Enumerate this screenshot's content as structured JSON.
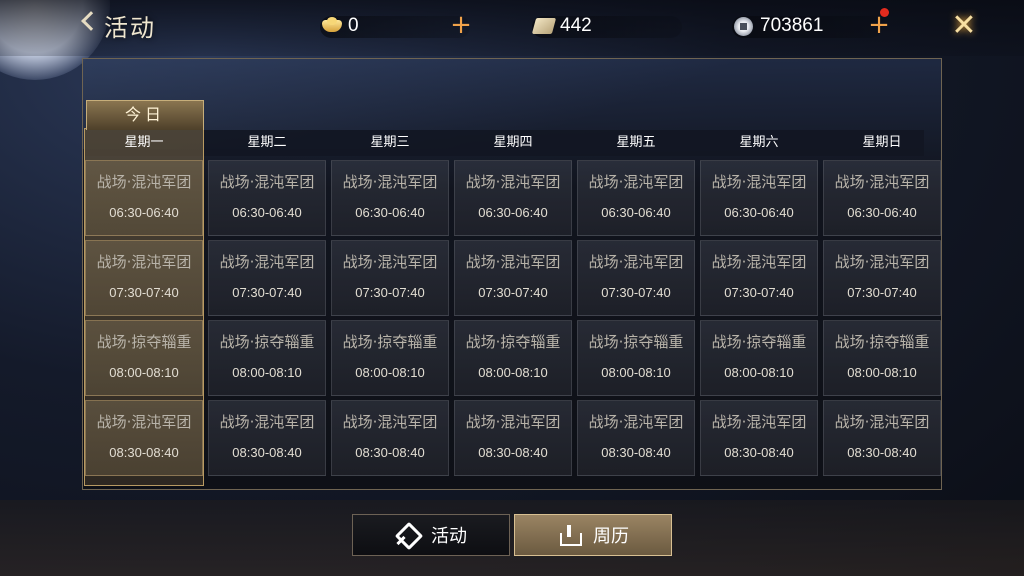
{
  "header": {
    "title": "活动",
    "currencies": [
      {
        "icon": "ingot-icon",
        "value": "0"
      },
      {
        "icon": "scroll-icon",
        "value": "442"
      },
      {
        "icon": "coin-icon",
        "value": "703861"
      }
    ],
    "plus_label": "+",
    "close_label": "✕"
  },
  "calendar": {
    "today_label": "今日",
    "days": [
      "星期一",
      "星期二",
      "星期三",
      "星期四",
      "星期五",
      "星期六",
      "星期日"
    ],
    "today_index": 0,
    "rows": [
      {
        "event": "战场·混沌军团",
        "time": "06:30-06:40"
      },
      {
        "event": "战场·混沌军团",
        "time": "07:30-07:40"
      },
      {
        "event": "战场·掠夺辎重",
        "time": "08:00-08:10"
      },
      {
        "event": "战场·混沌军团",
        "time": "08:30-08:40"
      }
    ]
  },
  "tabs": [
    {
      "label": "活动",
      "icon": "flag-icon",
      "active": false
    },
    {
      "label": "周历",
      "icon": "calendar-icon",
      "active": true
    }
  ],
  "colors": {
    "accent": "#f0a24a",
    "active_tab": "#9a8463",
    "notification": "#e32b1e"
  }
}
